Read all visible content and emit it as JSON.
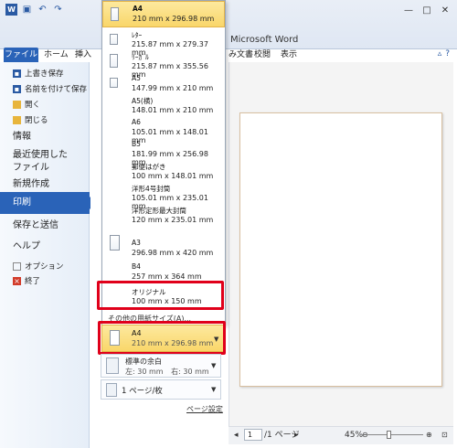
{
  "window": {
    "title": "Microsoft Word",
    "qat_icons": [
      "word-icon",
      "save-icon",
      "undo-icon",
      "redo-icon"
    ]
  },
  "ribbon": {
    "tabs": [
      "ファイル",
      "ホーム",
      "挿入",
      "み文書",
      "校閲",
      "表示"
    ]
  },
  "backstage": {
    "commands": [
      {
        "label": "上書き保存",
        "icon": "save-icon"
      },
      {
        "label": "名前を付けて保存",
        "icon": "save-as-icon"
      },
      {
        "label": "開く",
        "icon": "open-folder-icon"
      },
      {
        "label": "閉じる",
        "icon": "close-folder-icon"
      }
    ],
    "sections": [
      "情報",
      "最近使用した\nファイル",
      "新規作成",
      "印刷",
      "保存と送信",
      "ヘルプ"
    ],
    "bottom_commands": [
      {
        "label": "オプション",
        "icon": "options-icon"
      },
      {
        "label": "終了",
        "icon": "exit-icon"
      }
    ]
  },
  "paper_sizes": [
    {
      "name": "A4",
      "size": "210 mm x 296.98 mm",
      "selected": true
    },
    {
      "name": "ﾚﾀｰ",
      "size": "215.87 mm x 279.37 mm"
    },
    {
      "name": "ﾘｰｶﾞﾙ",
      "size": "215.87 mm x 355.56 mm"
    },
    {
      "name": "A5",
      "size": "147.99 mm x 210 mm"
    },
    {
      "name": "A5(横)",
      "size": "148.01 mm x 210 mm"
    },
    {
      "name": "A6",
      "size": "105.01 mm x 148.01 mm"
    },
    {
      "name": "B5",
      "size": "181.99 mm x 256.98 mm"
    },
    {
      "name": "郵便はがき",
      "size": "100 mm x 148.01 mm"
    },
    {
      "name": "洋形4号封筒",
      "size": "105.01 mm x 235.01 mm"
    },
    {
      "name": "洋形定形最大封筒",
      "size": "120 mm x 235.01 mm"
    },
    {
      "name": "A3",
      "size": "296.98 mm x 420 mm"
    },
    {
      "name": "B4",
      "size": "257 mm x 364 mm"
    },
    {
      "name": "オリジナル",
      "size": "100 mm x 150 mm",
      "highlighted": true
    }
  ],
  "more_paper_sizes": "その他の用紙サイズ(A)...",
  "current_paper": {
    "name": "A4",
    "size": "210 mm x 296.98 mm"
  },
  "margins": {
    "name": "標準の余白",
    "left_label": "左:",
    "left": "30 mm",
    "right_label": "右:",
    "right": "30 mm"
  },
  "pages_per_sheet": "1 ページ/枚",
  "page_setup_link": "ページ設定",
  "status": {
    "page_value": "1",
    "page_total": "/1 ページ",
    "zoom": "45%"
  },
  "colors": {
    "accent": "#2a63b8",
    "selection": "#f9d66a",
    "highlight_box": "#e0001a"
  }
}
